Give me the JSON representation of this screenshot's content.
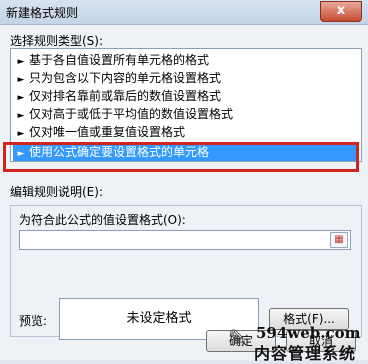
{
  "window": {
    "title": "新建格式规则",
    "close_glyph": "x"
  },
  "rule_type": {
    "label": "选择规则类型(S):",
    "items": [
      "基于各自值设置所有单元格的格式",
      "只为包含以下内容的单元格设置格式",
      "仅对排名靠前或靠后的数值设置格式",
      "仅对高于或低于平均值的数值设置格式",
      "仅对唯一值或重复值设置格式",
      "使用公式确定要设置格式的单元格"
    ],
    "selected_index": 5,
    "arrow": "►"
  },
  "edit": {
    "label": "编辑规则说明(E):",
    "formula_label": "为符合此公式的值设置格式(O):",
    "formula_value": ""
  },
  "preview": {
    "label": "预览:",
    "text": "未设定格式"
  },
  "buttons": {
    "format": "格式(F)...",
    "ok": "确定",
    "cancel": "取消"
  },
  "watermark": {
    "url": "594web.com",
    "text": "内容管理系统"
  },
  "colors": {
    "selection": "#3399ff",
    "highlight_outline": "#d0251e"
  }
}
